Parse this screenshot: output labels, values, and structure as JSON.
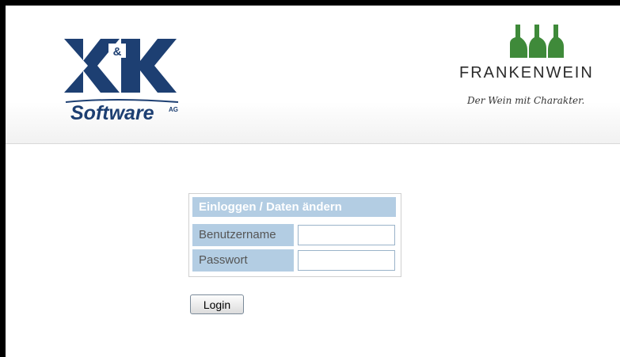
{
  "header": {
    "left_logo": {
      "name": "K&K Software AG",
      "letters_left": "K",
      "ampersand": "&",
      "letters_right": "K",
      "wordmark": "Software",
      "superscript": "AG",
      "color": "#1d3f72"
    },
    "right_logo": {
      "name": "FRANKENWEIN",
      "slogan": "Der Wein mit Charakter.",
      "bottle_color": "#3f8a3a"
    }
  },
  "login": {
    "title": "Einloggen / Daten ändern",
    "username_label": "Benutzername",
    "username_value": "",
    "password_label": "Passwort",
    "password_value": "",
    "button_label": "Login",
    "accent_color": "#b3cde3"
  }
}
